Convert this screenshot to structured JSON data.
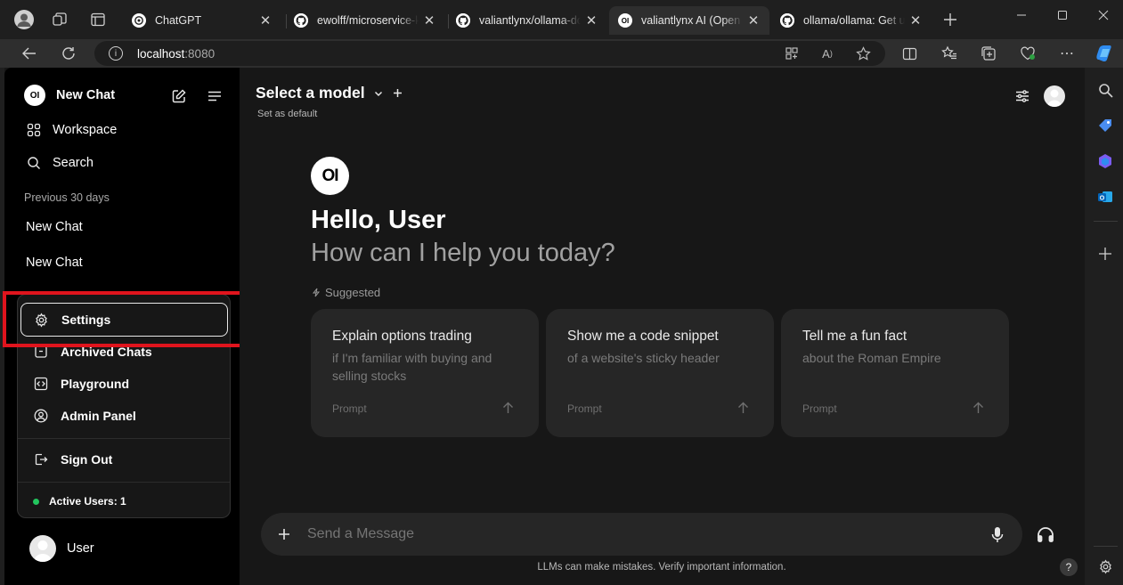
{
  "browser": {
    "tabs": [
      {
        "title": "ChatGPT",
        "active": false,
        "favicon": "openai-icon"
      },
      {
        "title": "ewolff/microservice-kafka",
        "active": false,
        "favicon": "github-icon"
      },
      {
        "title": "valiantlynx/ollama-docker",
        "active": false,
        "favicon": "github-icon"
      },
      {
        "title": "valiantlynx AI (Open WebUI)",
        "active": true,
        "favicon": "openwebui-icon"
      },
      {
        "title": "ollama/ollama: Get up and running",
        "active": false,
        "favicon": "github-icon"
      }
    ],
    "url_host": "localhost",
    "url_port": ":8080"
  },
  "sidebar": {
    "logo_text": "OI",
    "new_chat": "New Chat",
    "workspace": "Workspace",
    "search": "Search",
    "section_label": "Previous 30 days",
    "chats": [
      "New Chat",
      "New Chat"
    ],
    "user_name": "User"
  },
  "user_menu": {
    "settings": "Settings",
    "archived": "Archived Chats",
    "playground": "Playground",
    "admin": "Admin Panel",
    "signout": "Sign Out",
    "active_users": "Active Users: 1",
    "active_color": "#22c55e"
  },
  "header": {
    "model_select": "Select a model",
    "set_default": "Set as default"
  },
  "welcome": {
    "logo_text": "OI",
    "greeting": "Hello, User",
    "subtitle": "How can I help you today?",
    "suggested_label": "Suggested"
  },
  "suggestions": [
    {
      "title": "Explain options trading",
      "subtitle": "if I'm familiar with buying and selling stocks",
      "prompt": "Prompt"
    },
    {
      "title": "Show me a code snippet",
      "subtitle": "of a website's sticky header",
      "prompt": "Prompt"
    },
    {
      "title": "Tell me a fun fact",
      "subtitle": "about the Roman Empire",
      "prompt": "Prompt"
    }
  ],
  "composer": {
    "placeholder": "Send a Message"
  },
  "footer": {
    "disclaimer": "LLMs can make mistakes. Verify important information.",
    "help": "?"
  },
  "colors": {
    "highlight": "#e0141d",
    "accent_white": "#ffffff"
  }
}
